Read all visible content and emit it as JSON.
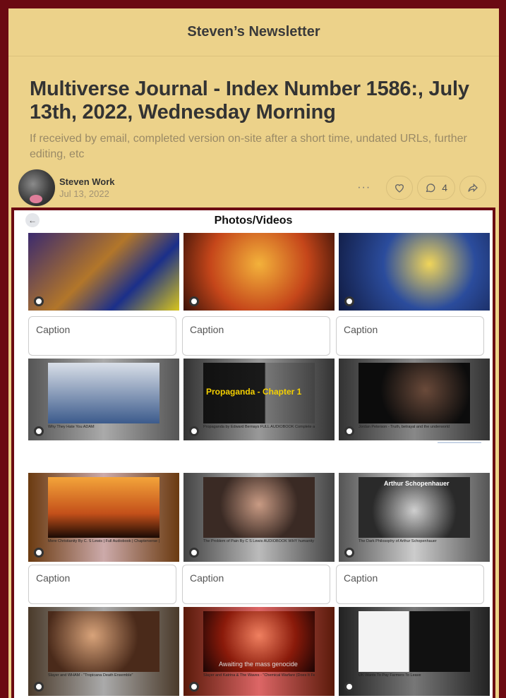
{
  "newsletter": {
    "name": "Steven’s Newsletter"
  },
  "post": {
    "title": "Multiverse Journal - Index Number 1586:, July 13th, 2022, Wednesday Morning",
    "subtitle": "If received by email, completed version on-site after a short time, undated URLs, further editing, etc",
    "author": "Steven Work",
    "date": "Jul 13, 2022",
    "comment_count": "4"
  },
  "embed": {
    "title": "Photos/Videos",
    "back_label": "←",
    "captions": [
      "Caption",
      "Caption",
      "Caption",
      "Caption",
      "Caption",
      "Caption"
    ],
    "videos": [
      {
        "title": "Why They Hate You ADAM"
      },
      {
        "title": "Propaganda by Edward Bernays FULL AUDIOBOOK Complete and Unabridged",
        "overlay": "Propaganda - Chapter 1"
      },
      {
        "title": "Jordan Peterson - Truth, betrayal and the underworld"
      },
      {
        "title": "Mere Christianity By C. S Lewis | Full Audiobook | Chapterverse | Narrated by Geoffrey Howard"
      },
      {
        "title": "The Problem of Pain By C S Lewis AUDIOBOOK WHY humanity SUFFER FULL UNABRIDGED"
      },
      {
        "title": "The Dark Philosophy of Arthur Schopenhauer",
        "overlay": "Arthur Schopenhauer"
      },
      {
        "title": "Slayer and WHAM - \"Tropicana Death Ensemble\""
      },
      {
        "title": "Slayer and Katrina & The Waves - \"Chemical Warfare (Does It Feel Good)\"",
        "overlay": "Awaiting the mass genocide"
      },
      {
        "title": "UK Wants To Pay Farmers To Leave"
      }
    ]
  },
  "colors": {
    "accent": "#6b0a12",
    "background": "#ecd28a"
  }
}
